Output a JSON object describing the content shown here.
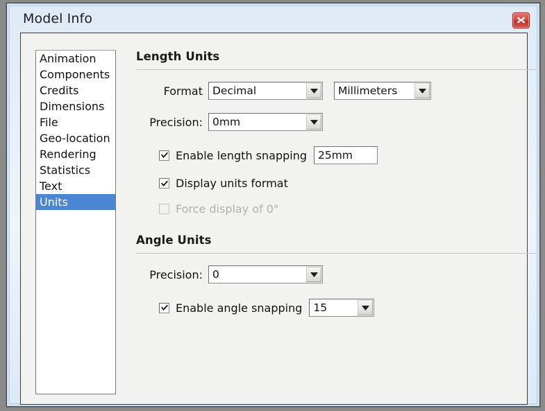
{
  "window": {
    "title": "Model Info",
    "close_icon": "close-x-icon",
    "accent_selected": "#4a86d4",
    "close_button_color": "#d9453c",
    "panel_background": "#f2f2f0"
  },
  "sidebar": {
    "items": [
      {
        "label": "Animation",
        "selected": false
      },
      {
        "label": "Components",
        "selected": false
      },
      {
        "label": "Credits",
        "selected": false
      },
      {
        "label": "Dimensions",
        "selected": false
      },
      {
        "label": "File",
        "selected": false
      },
      {
        "label": "Geo-location",
        "selected": false
      },
      {
        "label": "Rendering",
        "selected": false
      },
      {
        "label": "Statistics",
        "selected": false
      },
      {
        "label": "Text",
        "selected": false
      },
      {
        "label": "Units",
        "selected": true
      }
    ]
  },
  "length_units": {
    "heading": "Length Units",
    "format_label": "Format",
    "format_value": "Decimal",
    "unit_value": "Millimeters",
    "precision_label": "Precision:",
    "precision_value": "0mm",
    "length_snapping_label": "Enable length snapping",
    "length_snapping_checked": true,
    "length_snapping_value": "25mm",
    "display_units_label": "Display units format",
    "display_units_checked": true,
    "force_zero_label": "Force display of 0\"",
    "force_zero_checked": false,
    "force_zero_disabled": true
  },
  "angle_units": {
    "heading": "Angle Units",
    "precision_label": "Precision:",
    "precision_value": "0",
    "angle_snapping_label": "Enable angle snapping",
    "angle_snapping_checked": true,
    "angle_snapping_value": "15"
  },
  "icons": {
    "dropdown": "chevron-down-icon",
    "check": "checkmark-icon"
  }
}
